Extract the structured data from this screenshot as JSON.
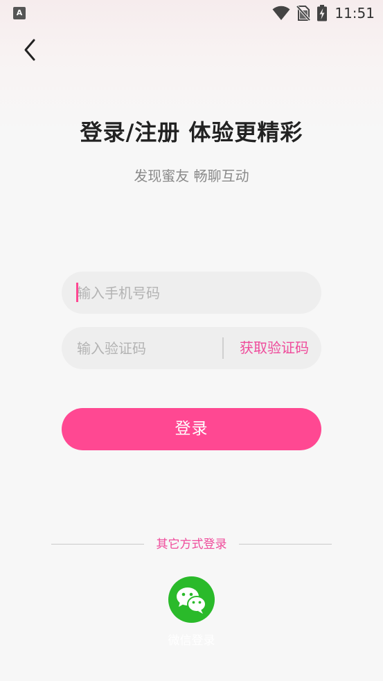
{
  "status_bar": {
    "app_icon_letter": "A",
    "time": "11:51",
    "icons": [
      "wifi-icon",
      "no-sim-icon",
      "battery-charging-icon"
    ]
  },
  "header": {
    "back_icon": "chevron-left-icon"
  },
  "main": {
    "title": "登录/注册 体验更精彩",
    "subtitle": "发现蜜友 畅聊互动"
  },
  "form": {
    "phone_placeholder": "输入手机号码",
    "phone_value": "",
    "code_placeholder": "输入验证码",
    "code_value": "",
    "get_code_label": "获取验证码",
    "login_label": "登录"
  },
  "other_login": {
    "divider_text": "其它方式登录",
    "wechat_label": "微信登录",
    "wechat_icon": "wechat-icon"
  },
  "colors": {
    "accent": "#ff4892",
    "link": "#ef4b9b",
    "wechat": "#2aba2a"
  }
}
